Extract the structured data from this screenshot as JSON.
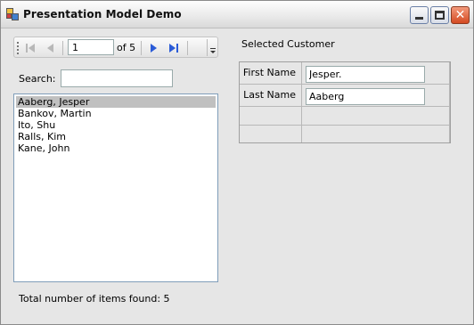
{
  "window": {
    "title": "Presentation Model Demo",
    "close_glyph": "✕"
  },
  "navigator": {
    "position": "1",
    "count_text": "of 5"
  },
  "search": {
    "label": "Search:",
    "value": ""
  },
  "list": {
    "items": [
      "Aaberg, Jesper",
      "Bankov, Martin",
      "Ito, Shu",
      "Ralls, Kim",
      "Kane, John"
    ],
    "selected_index": 0
  },
  "status": {
    "total_text": "Total number of items found:  5"
  },
  "detail": {
    "heading": "Selected Customer",
    "first_name_label": "First Name",
    "first_name_value": "Jesper.",
    "last_name_label": "Last Name",
    "last_name_value": "Aaberg"
  }
}
